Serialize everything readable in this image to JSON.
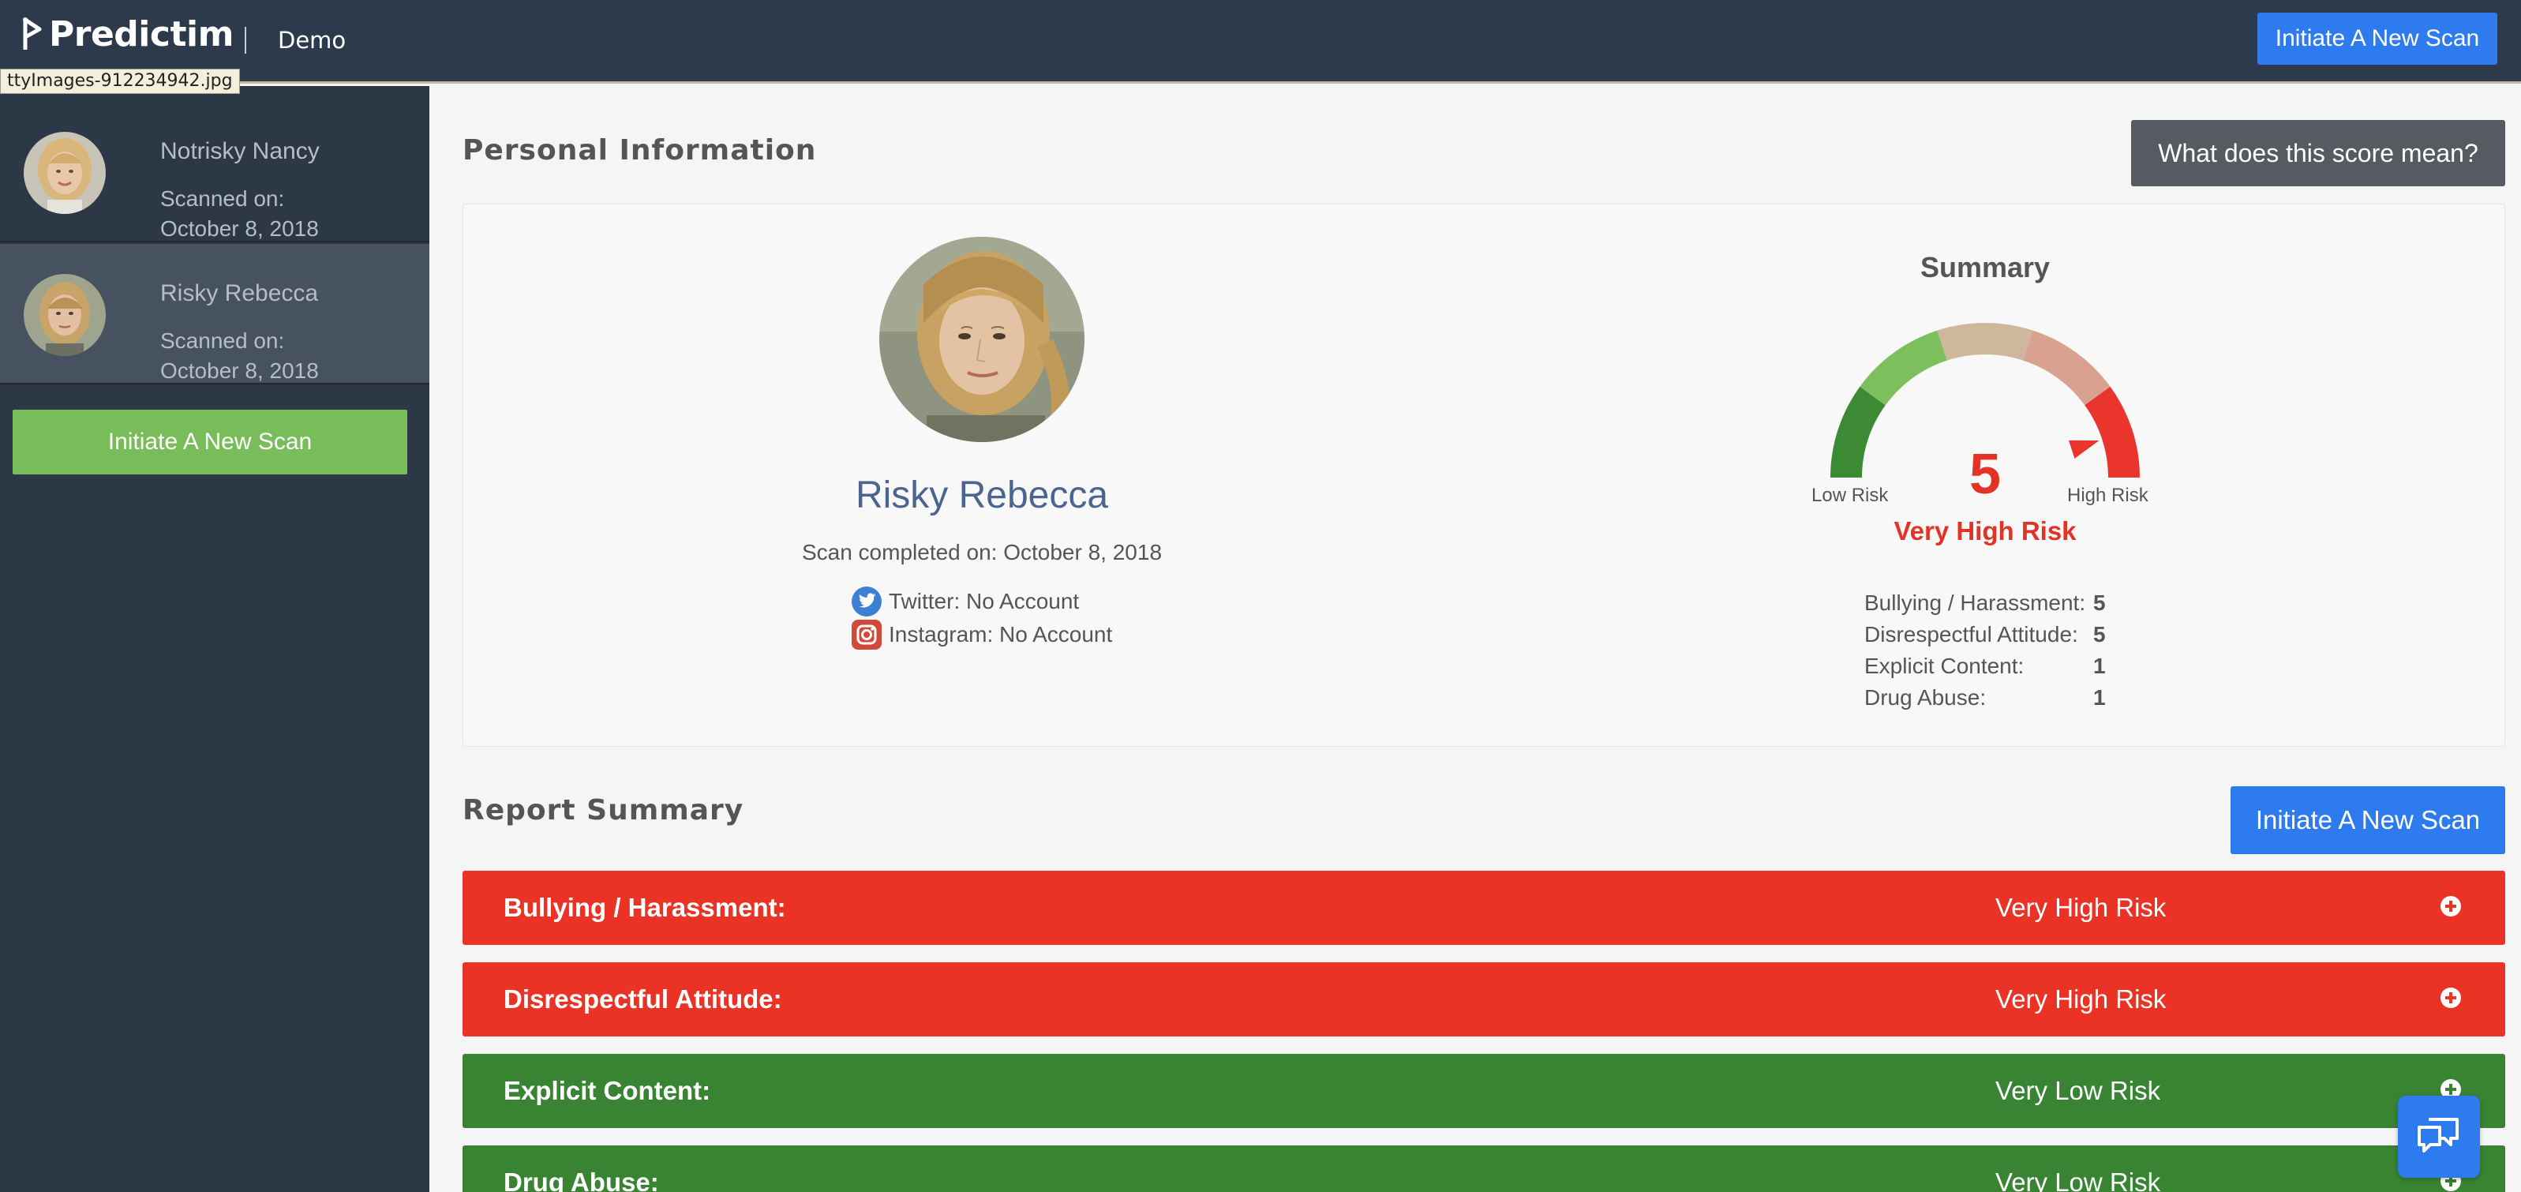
{
  "topbar": {
    "brand": "Predictim",
    "env": "Demo",
    "scan_button": "Initiate A New Scan"
  },
  "tooltip": {
    "filename": "ttyImages-912234942.jpg"
  },
  "sidebar": {
    "people": [
      {
        "name": "Notrisky Nancy",
        "scanned_label": "Scanned on:",
        "date": "October 8, 2018",
        "active": false
      },
      {
        "name": "Risky Rebecca",
        "scanned_label": "Scanned on:",
        "date": "October 8, 2018",
        "active": true
      }
    ],
    "scan_button": "Initiate A New Scan"
  },
  "personal": {
    "section_title": "Personal Information",
    "score_button": "What does this score mean?",
    "name": "Risky Rebecca",
    "scan_completed": "Scan completed on: October 8, 2018",
    "twitter": "Twitter: No Account",
    "instagram": "Instagram: No Account"
  },
  "summary": {
    "title": "Summary",
    "score": "5",
    "score_value": 5,
    "score_max": 5,
    "low_label": "Low Risk",
    "high_label": "High Risk",
    "risk_level": "Very High Risk",
    "categories": [
      {
        "label": "Bullying / Harassment:",
        "value": "5"
      },
      {
        "label": "Disrespectful Attitude:",
        "value": "5"
      },
      {
        "label": "Explicit Content:",
        "value": "1"
      },
      {
        "label": "Drug Abuse:",
        "value": "1"
      }
    ],
    "colors": {
      "dark_green": "#3d8a34",
      "light_green": "#7cbf5c",
      "tan": "#cfb79c",
      "light_red": "#d9a190",
      "red": "#e9352b"
    }
  },
  "report": {
    "section_title": "Report Summary",
    "scan_button": "Initiate A New Scan",
    "rows": [
      {
        "label": "Bullying / Harassment:",
        "risk": "Very High Risk",
        "status": "red"
      },
      {
        "label": "Disrespectful Attitude:",
        "risk": "Very High Risk",
        "status": "red"
      },
      {
        "label": "Explicit Content:",
        "risk": "Very Low Risk",
        "status": "green"
      },
      {
        "label": "Drug Abuse:",
        "risk": "Very Low Risk",
        "status": "green"
      }
    ]
  },
  "icons": {
    "twitter": "twitter-icon",
    "instagram": "instagram-icon",
    "chat": "chat-icon",
    "expand": "plus-circle-icon"
  }
}
